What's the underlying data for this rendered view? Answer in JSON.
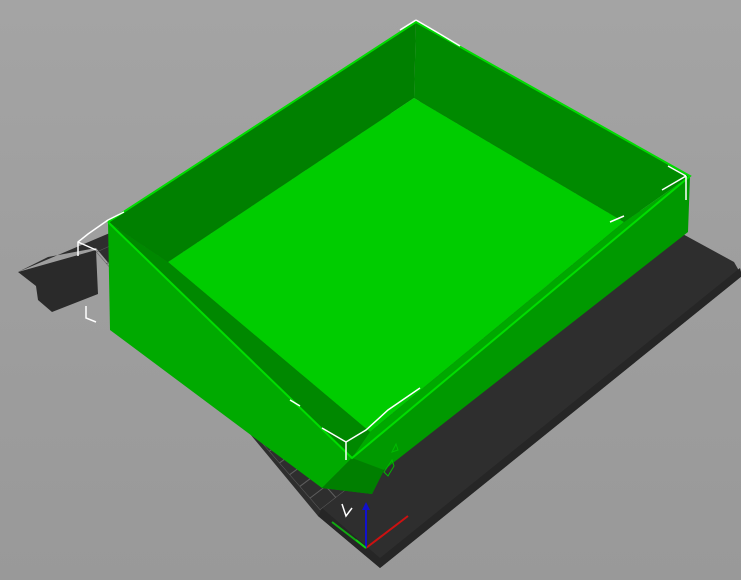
{
  "viewport": {
    "background_top": "#a4a4a4",
    "background_bottom": "#999999"
  },
  "bed": {
    "plate_color": "#2e2e2e",
    "grid_color": "#5e5e5e",
    "grid_divisions": 22
  },
  "model": {
    "shape": "open-top tray / box",
    "state": "selected",
    "colors": {
      "floor": "#00cc00",
      "inner_wall_far": "#008000",
      "inner_wall_right": "#008a00",
      "inner_wall_left": "#007a00",
      "outer_wall_front": "#009900",
      "outer_wall_left": "#00aa00",
      "rim": "#00bb00"
    },
    "bounding_box_color": "#ffffff"
  },
  "axes": {
    "x_color": "#cc1111",
    "y_color": "#11aa11",
    "z_color": "#1111cc"
  }
}
